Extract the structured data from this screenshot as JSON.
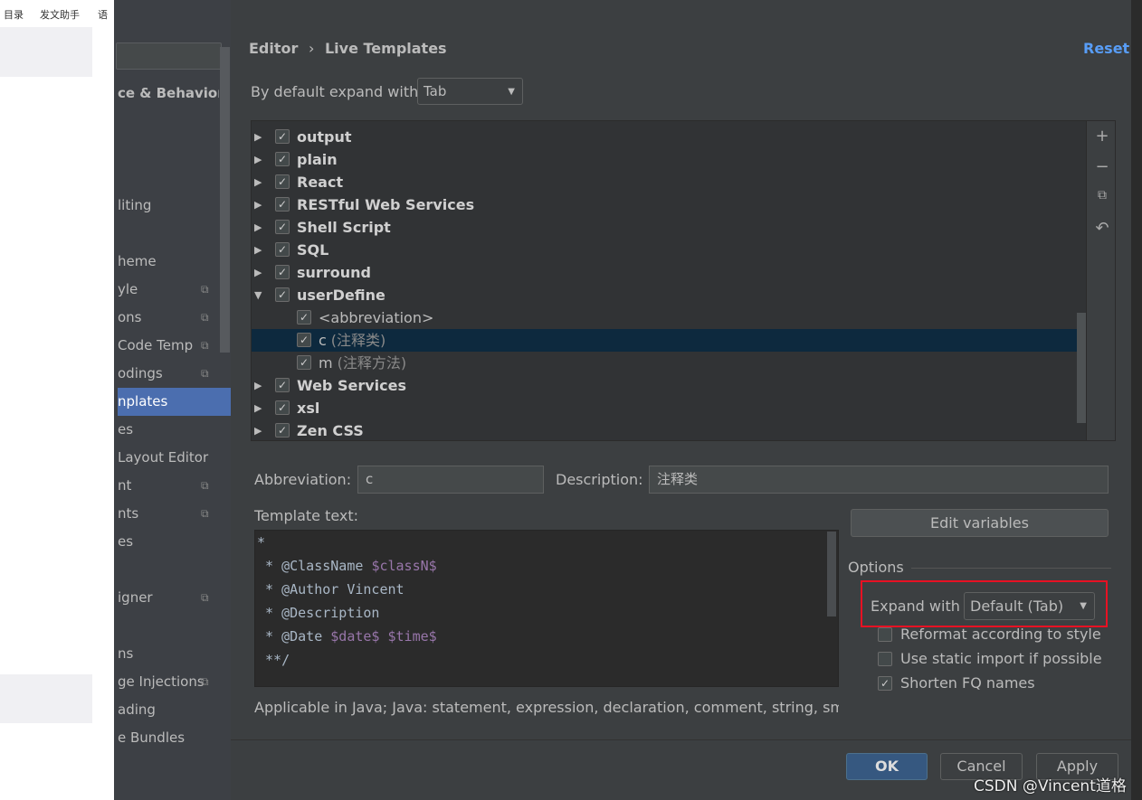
{
  "browser_toolbar": [
    "目录",
    "发文助手",
    "语"
  ],
  "sidebar": {
    "items": [
      {
        "label": "ce & Behavior",
        "bold": true
      },
      {
        "label": "liting"
      },
      {
        "label": "heme"
      },
      {
        "label": "yle",
        "copy": true
      },
      {
        "label": "ons",
        "copy": true
      },
      {
        "label": " Code Temp",
        "copy": true
      },
      {
        "label": "odings",
        "copy": true
      },
      {
        "label": "nplates",
        "selected": true
      },
      {
        "label": "es"
      },
      {
        "label": " Layout Editor"
      },
      {
        "label": "nt",
        "copy": true
      },
      {
        "label": "nts",
        "copy": true
      },
      {
        "label": "es"
      },
      {
        "label": "igner",
        "copy": true
      },
      {
        "label": "ns"
      },
      {
        "label": "ge Injections",
        "copy": true
      },
      {
        "label": "ading"
      },
      {
        "label": "e Bundles"
      }
    ]
  },
  "header": {
    "breadcrumb": [
      "Editor",
      "Live Templates"
    ],
    "separator": "›",
    "reset": "Reset"
  },
  "expand_default": {
    "label": "By default expand with",
    "value": "Tab"
  },
  "tree": [
    {
      "label": "output",
      "group": true,
      "checked": true
    },
    {
      "label": "plain",
      "group": true,
      "checked": true
    },
    {
      "label": "React",
      "group": true,
      "checked": true
    },
    {
      "label": "RESTful Web Services",
      "group": true,
      "checked": true
    },
    {
      "label": "Shell Script",
      "group": true,
      "checked": true
    },
    {
      "label": "SQL",
      "group": true,
      "checked": true
    },
    {
      "label": "surround",
      "group": true,
      "checked": true
    },
    {
      "label": "userDefine",
      "group": true,
      "checked": true,
      "expanded": true
    },
    {
      "label": "<abbreviation>",
      "group": false,
      "checked": true,
      "hint": ""
    },
    {
      "label": "c",
      "group": false,
      "checked": true,
      "hint": "(注释类)",
      "selected": true
    },
    {
      "label": "m",
      "group": false,
      "checked": true,
      "hint": "(注释方法)"
    },
    {
      "label": "Web Services",
      "group": true,
      "checked": true
    },
    {
      "label": "xsl",
      "group": true,
      "checked": true
    },
    {
      "label": "Zen CSS",
      "group": true,
      "checked": true
    }
  ],
  "tree_tools": [
    "plus-icon",
    "minus-icon",
    "copy-icon",
    "revert-icon"
  ],
  "form": {
    "abbreviation_label": "Abbreviation:",
    "abbreviation": "c",
    "description_label": "Description:",
    "description": "注释类",
    "template_label": "Template text:",
    "edit_variables": "Edit variables",
    "template_lines": [
      [
        {
          "t": "*"
        }
      ],
      [
        {
          "t": " * @ClassName "
        },
        {
          "t": "$classN$",
          "v": true
        }
      ],
      [
        {
          "t": " * @Author Vincent"
        }
      ],
      [
        {
          "t": " * @Description"
        }
      ],
      [
        {
          "t": " * @Date "
        },
        {
          "t": "$date$",
          "v": true
        },
        {
          "t": " "
        },
        {
          "t": "$time$",
          "v": true
        }
      ],
      [
        {
          "t": " **/"
        }
      ]
    ],
    "applicable": "Applicable in Java; Java: statement, expression, declaration, comment, string, smart ty"
  },
  "options": {
    "title": "Options",
    "expand_with_label": "Expand with",
    "expand_with_value": "Default (Tab)",
    "checkboxes": [
      {
        "label": "Reformat according to style",
        "checked": false
      },
      {
        "label": "Use static import if possible",
        "checked": false
      },
      {
        "label": "Shorten FQ names",
        "checked": true
      }
    ],
    "highlight_color": "#e81123"
  },
  "buttons": {
    "ok": "OK",
    "cancel": "Cancel",
    "apply": "Apply"
  },
  "watermark": "CSDN @Vincent道格",
  "colors": {
    "accent": "#4b6eaf",
    "link": "#589df6",
    "selected_row": "#0d293e"
  }
}
